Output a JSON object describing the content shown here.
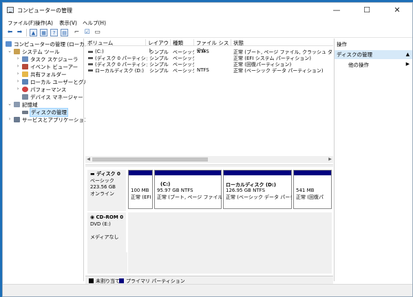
{
  "window": {
    "title": "コンピューターの管理"
  },
  "window_controls": {
    "minimize": "—",
    "maximize": "☐",
    "close": "✕"
  },
  "menu": {
    "file": "ファイル(F)",
    "action": "操作(A)",
    "view": "表示(V)",
    "help": "ヘルプ(H)"
  },
  "tree": {
    "root": "コンピューターの管理 (ローカル)",
    "system_tools": "システム ツール",
    "task_scheduler": "タスク スケジューラ",
    "event_viewer": "イベント ビューアー",
    "shared_folders": "共有フォルダー",
    "local_users": "ローカル ユーザーとグループ",
    "performance": "パフォーマンス",
    "device_manager": "デバイス マネージャー",
    "storage": "記憶域",
    "disk_management": "ディスクの管理",
    "services": "サービスとアプリケーション"
  },
  "volumes": {
    "columns": {
      "volume": "ボリューム",
      "layout": "レイアウト",
      "type": "種類",
      "filesystem": "ファイル システム",
      "status": "状態"
    },
    "rows": [
      {
        "volume": "(C:)",
        "layout": "シンプル",
        "type": "ベーシック",
        "fs": "NTFS",
        "status": "正常 (ブート, ページ ファイル, クラッシュ ダンプ, ベーシ"
      },
      {
        "volume": "(ディスク 0 パーティション 1)",
        "layout": "シンプル",
        "type": "ベーシック",
        "fs": "",
        "status": "正常 (EFI システム パーティション)"
      },
      {
        "volume": "(ディスク 0 パーティション 4)",
        "layout": "シンプル",
        "type": "ベーシック",
        "fs": "",
        "status": "正常 (回復パーティション)"
      },
      {
        "volume": "ローカルディスク (D:)",
        "layout": "シンプル",
        "type": "ベーシック",
        "fs": "NTFS",
        "status": "正常 (ベーシック データ パーティション)"
      }
    ]
  },
  "disk0": {
    "name": "ディスク 0",
    "type": "ベーシック",
    "size": "223.56 GB",
    "state": "オンライン",
    "partitions": [
      {
        "name": "",
        "size": "100 MB",
        "status": "正常 (EFI"
      },
      {
        "name": "(C:)",
        "size": "95.97 GB NTFS",
        "status": "正常 (ブート, ページ ファイル, クラ"
      },
      {
        "name": "ローカルディスク (D:)",
        "size": "126.95 GB NTFS",
        "status": "正常 (ベーシック データ パーティション)"
      },
      {
        "name": "",
        "size": "541 MB",
        "status": "正常 (回復パ"
      }
    ]
  },
  "cdrom": {
    "name": "CD-ROM 0",
    "drive": "DVD (E:)",
    "media": "メディアなし"
  },
  "legend": {
    "unallocated": "未割り当て",
    "primary": "プライマリ パーティション",
    "unallocated_color": "#000000",
    "primary_color": "#00007f"
  },
  "actions": {
    "header": "操作",
    "section": "ディスクの管理",
    "other": "他の操作"
  }
}
